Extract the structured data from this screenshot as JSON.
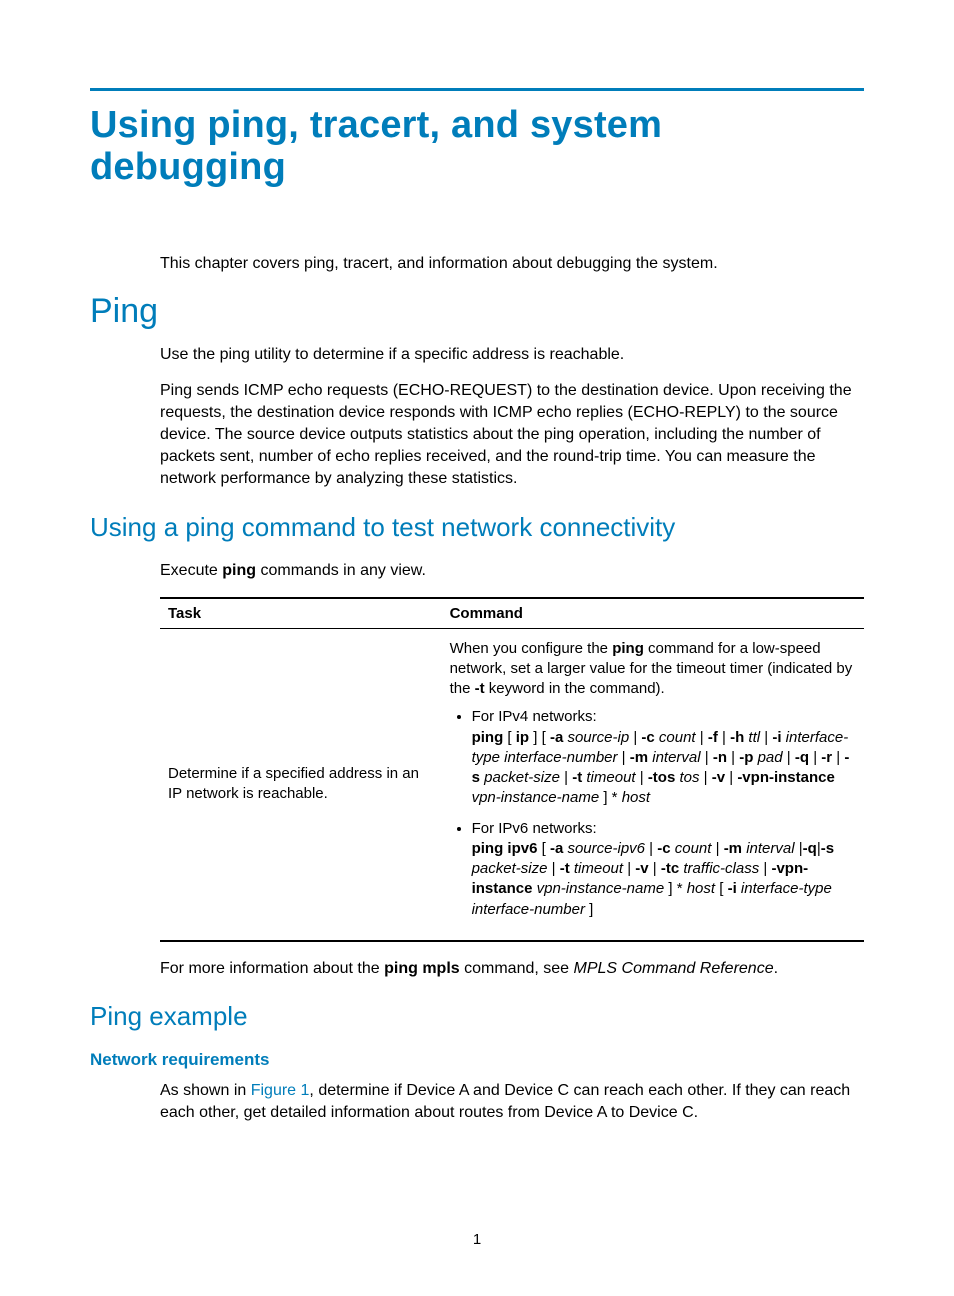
{
  "title": "Using ping, tracert, and system debugging",
  "intro": "This chapter covers ping, tracert, and information about debugging the system.",
  "ping": {
    "heading": "Ping",
    "p1": "Use the ping utility to determine if a specific address is reachable.",
    "p2": "Ping sends ICMP echo requests (ECHO-REQUEST) to the destination device. Upon receiving the requests, the destination device responds with ICMP echo replies (ECHO-REPLY) to the source device. The source device outputs statistics about the ping operation, including the number of packets sent, number of echo replies received, and the round-trip time. You can measure the network performance by analyzing these statistics."
  },
  "using": {
    "heading": "Using a ping command to test network connectivity",
    "exec_pre": "Execute ",
    "exec_bold": "ping",
    "exec_post": " commands in any view.",
    "table": {
      "col_task": "Task",
      "col_cmd": "Command",
      "task": "Determine if a specified address in an IP network is reachable.",
      "pre": {
        "a": "When you configure the ",
        "b": "ping",
        "c": " command for a low-speed network, set a larger value for the timeout timer (indicated by the ",
        "d": "-t",
        "e": " keyword in the command)."
      },
      "ipv4": {
        "label": "For IPv4 networks:",
        "parts": {
          "p1": "ping",
          "p2": " [ ",
          "p3": "ip",
          "p4": " ] [ ",
          "p5": "-a",
          "p6": " source-ip",
          "p7": " | ",
          "p8": "-c",
          "p9": " count",
          "p10": " | ",
          "p11": "-f",
          "p12": " | ",
          "p13": "-h",
          "p14": " ttl",
          "p15": " | ",
          "p16": "-i",
          "p17": " interface-type interface-number",
          "p18": " | ",
          "p19": "-m",
          "p20": " interval",
          "p21": " | ",
          "p22": "-n",
          "p23": " | ",
          "p24": "-p",
          "p25": " pad",
          "p26": " | ",
          "p27": "-q",
          "p28": " | ",
          "p29": "-r",
          "p30": " | ",
          "p31": "-s",
          "p32": " packet-size",
          "p33": " | ",
          "p34": "-t",
          "p35": " timeout",
          "p36": " | ",
          "p37": "-tos",
          "p38": " tos",
          "p39": " | ",
          "p40": "-v",
          "p41": " | ",
          "p42": "-vpn-instance",
          "p43": " vpn-instance-name",
          "p44": " ] * ",
          "p45": "host"
        }
      },
      "ipv6": {
        "label": "For IPv6 networks:",
        "parts": {
          "p1": "ping ipv6",
          "p2": " [ ",
          "p3": "-a",
          "p4": " source-ipv6",
          "p5": " | ",
          "p6": "-c",
          "p7": " count",
          "p8": " | ",
          "p9": "-m",
          "p10": " interval",
          "p11": " |",
          "p12": "-q",
          "p13": "|",
          "p14": "-s",
          "p15": " packet-size",
          "p16": " | ",
          "p17": "-t",
          "p18": " timeout",
          "p19": " | ",
          "p20": "-v",
          "p21": " | ",
          "p22": "-tc",
          "p23": " traffic-class",
          "p24": " | ",
          "p25": "-vpn-instance",
          "p26": " vpn-instance-name",
          "p27": " ] * ",
          "p28": "host",
          "p29": " [ ",
          "p30": "-i",
          "p31": " interface-type interface-number",
          "p32": " ]"
        }
      }
    },
    "more": {
      "a": "For more information about the ",
      "b": "ping mpls",
      "c": " command, see ",
      "d": "MPLS Command Reference",
      "e": "."
    }
  },
  "example": {
    "heading": "Ping example",
    "netreq_heading": "Network requirements",
    "p1a": "As shown in ",
    "p1link": "Figure 1",
    "p1b": ", determine if Device A and Device C can reach each other. If they can reach each other, get detailed information about routes from Device A to Device C."
  },
  "pagenum": "1"
}
